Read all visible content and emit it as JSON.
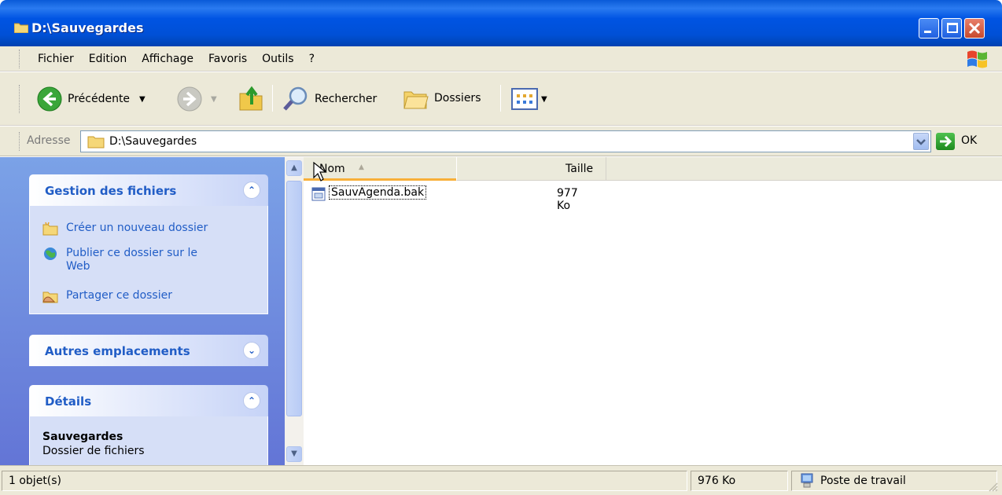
{
  "window": {
    "title": "D:\\Sauvegardes"
  },
  "menu": [
    "Fichier",
    "Edition",
    "Affichage",
    "Favoris",
    "Outils",
    "?"
  ],
  "toolbar": {
    "back_label": "Précédente",
    "search_label": "Rechercher",
    "folders_label": "Dossiers"
  },
  "address": {
    "label": "Adresse",
    "value": "D:\\Sauvegardes",
    "go_label": "OK"
  },
  "taskpane": {
    "file_tasks": {
      "title": "Gestion des fichiers",
      "items": [
        "Créer un nouveau dossier",
        "Publier ce dossier sur le Web",
        "Partager ce dossier"
      ]
    },
    "other_places": {
      "title": "Autres emplacements"
    },
    "details": {
      "title": "Détails",
      "name": "Sauvegardes",
      "type": "Dossier de fichiers"
    }
  },
  "filelist": {
    "columns": {
      "name": "Nom",
      "size": "Taille"
    },
    "rows": [
      {
        "name": "SauvAgenda.bak",
        "size": "977 Ko"
      }
    ]
  },
  "status": {
    "count": "1 objet(s)",
    "size": "976 Ko",
    "location": "Poste de travail"
  },
  "colors": {
    "title_blue": "#0054e3",
    "task_link": "#215dc6",
    "sort_highlight": "#f8b03a"
  }
}
